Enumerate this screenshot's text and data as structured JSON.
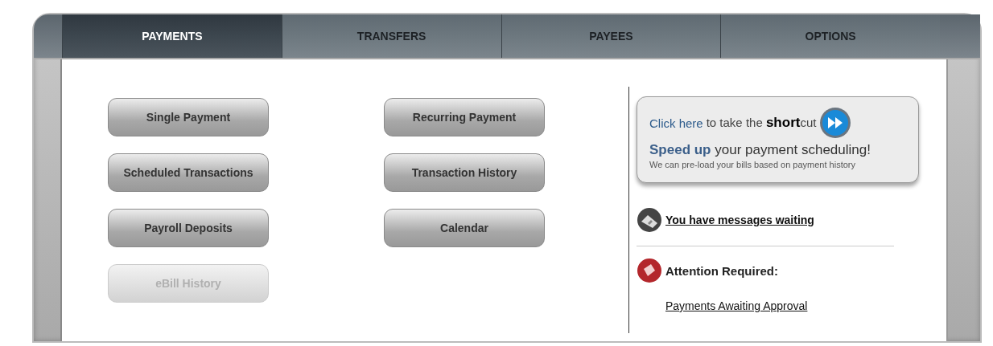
{
  "tabs": [
    {
      "label": "PAYMENTS",
      "selected": true
    },
    {
      "label": "TRANSFERS",
      "selected": false
    },
    {
      "label": "PAYEES",
      "selected": false
    },
    {
      "label": "OPTIONS",
      "selected": false
    }
  ],
  "actions": [
    [
      {
        "label": "Single Payment",
        "disabled": false
      },
      {
        "label": "Scheduled Transactions",
        "disabled": false
      },
      {
        "label": "Payroll Deposits",
        "disabled": false
      },
      {
        "label": "eBill History",
        "disabled": true
      }
    ],
    [
      {
        "label": "Recurring Payment",
        "disabled": false
      },
      {
        "label": "Transaction History",
        "disabled": false
      },
      {
        "label": "Calendar",
        "disabled": false
      }
    ]
  ],
  "promo": {
    "link": "Click here",
    "text": "to take the **short**cut",
    "headline": "**Speed up** your payment scheduling!",
    "note": "We can pre-load your bills based on payment history"
  },
  "messages": {
    "link": "You have messages waiting"
  },
  "attention": {
    "title": "Attention Required:",
    "links": [
      "Payments Awaiting Approval"
    ]
  }
}
